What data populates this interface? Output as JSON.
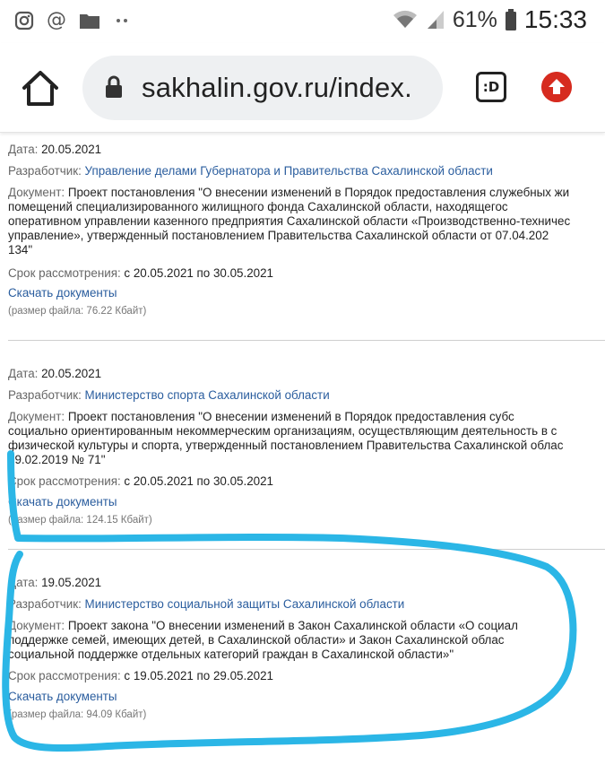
{
  "status_bar": {
    "left_icons": [
      "instagram-icon",
      "at-sign-icon",
      "folder-icon",
      "more-dots-icon"
    ],
    "battery_percent": "61%",
    "time": "15:33"
  },
  "browser": {
    "url": "sakhalin.gov.ru/index.",
    "extension_label": ":D"
  },
  "entries": [
    {
      "date_label": "Дата:",
      "date": "20.05.2021",
      "developer_label": "Разработчик:",
      "developer": "Управление делами Губернатора и Правительства Сахалинской области",
      "document_label": "Документ:",
      "document_lines": [
        "Проект постановления \"О внесении изменений в Порядок предоставления служебных жи",
        "помещений специализированного жилищного фонда Сахалинской области, находящегос",
        "оперативном управлении казенного предприятия Сахалинской области «Производственно-техничес",
        "управление», утвержденный постановлением Правительства Сахалинской области от 07.04.202",
        "134\""
      ],
      "period_label": "Срок рассмотрения:",
      "period": "с 20.05.2021 по 30.05.2021",
      "download_label": "Скачать документы",
      "file_size": "(размер файла: 76.22 Кбайт)"
    },
    {
      "date_label": "Дата:",
      "date": "20.05.2021",
      "developer_label": "Разработчик:",
      "developer": "Министерство спорта Сахалинской области",
      "document_label": "Документ:",
      "document_lines": [
        "Проект постановления \"О внесении изменений в Порядок предоставления субс",
        "социально ориентированным некоммерческим организациям, осуществляющим деятельность в с",
        "физической культуры и спорта, утвержденный постановлением Правительства Сахалинской облас",
        "19.02.2019 № 71\""
      ],
      "period_label": "Срок рассмотрения:",
      "period": "с 20.05.2021 по 30.05.2021",
      "download_label": "Скачать документы",
      "file_size": "(размер файла: 124.15 Кбайт)"
    },
    {
      "date_label": "Дата:",
      "date": "19.05.2021",
      "developer_label": "Разработчик:",
      "developer": "Министерство социальной защиты Сахалинской области",
      "document_label": "Документ:",
      "document_lines": [
        "Проект закона \"О внесении изменений в Закон Сахалинской области «О социал",
        "поддержке семей, имеющих детей, в Сахалинской области» и Закон Сахалинской облас",
        "социальной поддержке отдельных категорий граждан в Сахалинской области»\""
      ],
      "period_label": "Срок рассмотрения:",
      "period": "с 19.05.2021 по 29.05.2021",
      "download_label": "Скачать документы",
      "file_size": "(размер файла: 94.09 Кбайт)"
    }
  ],
  "colors": {
    "link": "#2a5d9e",
    "annotation": "#2bb6e6",
    "update_button": "#d62b1f"
  }
}
